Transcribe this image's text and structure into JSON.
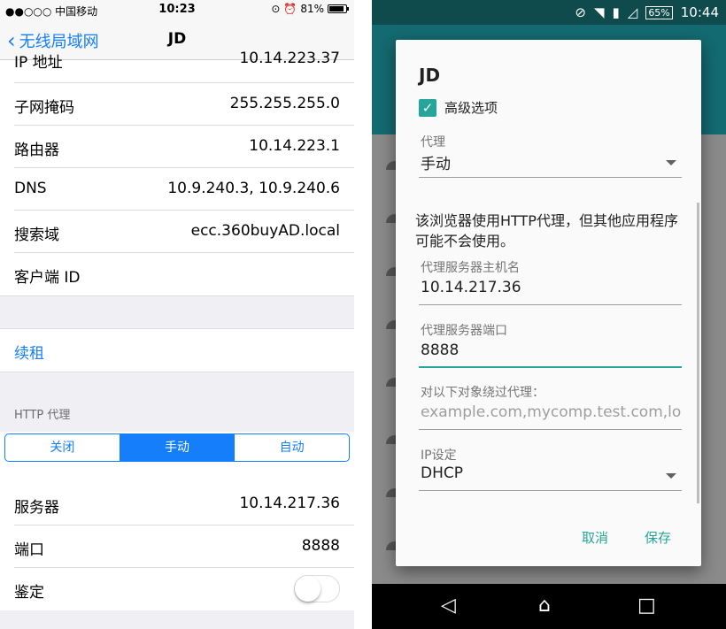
{
  "ios": {
    "status": {
      "carrier": "●●○○○ 中国移动",
      "time": "10:23",
      "battery": "81%"
    },
    "nav": {
      "back_label": "无线局域网",
      "title": "JD"
    },
    "rows": [
      {
        "label": "IP 地址",
        "value": "10.14.223.37"
      },
      {
        "label": "子网掩码",
        "value": "255.255.255.0"
      },
      {
        "label": "路由器",
        "value": "10.14.223.1"
      },
      {
        "label": "DNS",
        "value": "10.9.240.3, 10.9.240.6"
      },
      {
        "label": "搜索域",
        "value": "ecc.360buyAD.local"
      },
      {
        "label": "客户端 ID",
        "value": ""
      }
    ],
    "renew_label": "续租",
    "http_proxy_header": "HTTP 代理",
    "segments": [
      "关闭",
      "手动",
      "自动"
    ],
    "selected_segment": "手动",
    "proxy_rows": [
      {
        "label": "服务器",
        "value": "10.14.217.36"
      },
      {
        "label": "端口",
        "value": "8888"
      }
    ],
    "auth_label": "鉴定",
    "auth_enabled": false,
    "accent_color": "#147efb"
  },
  "android": {
    "status": {
      "battery": "65%",
      "time": "10:44"
    },
    "dialog": {
      "title": "JD",
      "advanced_label": "高级选项",
      "advanced_checked": true,
      "proxy_label": "代理",
      "proxy_value": "手动",
      "warning": "该浏览器使用HTTP代理，但其他应用程序可能不会使用。",
      "host_label": "代理服务器主机名",
      "host_value": "10.14.217.36",
      "port_label": "代理服务器端口",
      "port_value": "8888",
      "bypass_label": "对以下对象绕过代理：",
      "bypass_placeholder": "example.com,mycomp.test.com,lo",
      "ip_label": "IP设定",
      "ip_value": "DHCP",
      "cancel_label": "取消",
      "save_label": "保存"
    },
    "accent_color": "#26a69a"
  }
}
